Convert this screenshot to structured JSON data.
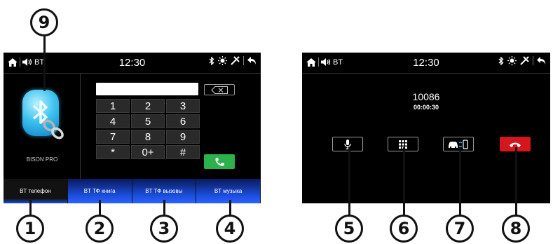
{
  "callouts": [
    "9",
    "1",
    "2",
    "3",
    "4",
    "5",
    "6",
    "7",
    "8"
  ],
  "left_screen": {
    "status_bar": {
      "bt_label": "BT",
      "time": "12:30"
    },
    "device_name": "BISON PRO",
    "number_input_value": "",
    "keypad": [
      "1",
      "2",
      "3",
      "4",
      "5",
      "6",
      "7",
      "8",
      "9",
      "*",
      "0+",
      "#"
    ],
    "tabs": [
      {
        "label": "BT телефон",
        "active": true
      },
      {
        "label": "BT ТФ книга",
        "active": false
      },
      {
        "label": "BT ТФ вызовы",
        "active": false
      },
      {
        "label": "BT музыка",
        "active": false
      }
    ]
  },
  "right_screen": {
    "status_bar": {
      "bt_label": "BT",
      "time": "12:30"
    },
    "call_number": "10086",
    "call_timer": "00:00:30",
    "controls": [
      "microphone-icon",
      "dialpad-icon",
      "car-phone-switch-icon",
      "hang-up-icon"
    ]
  },
  "icons": [
    "home-icon",
    "volume-icon",
    "bluetooth-icon",
    "brightness-icon",
    "settings-icon",
    "back-icon"
  ],
  "colors": {
    "call_green": "#2bb24a",
    "end_red": "#d4161d",
    "tab_blue": "#1c4fe0"
  }
}
